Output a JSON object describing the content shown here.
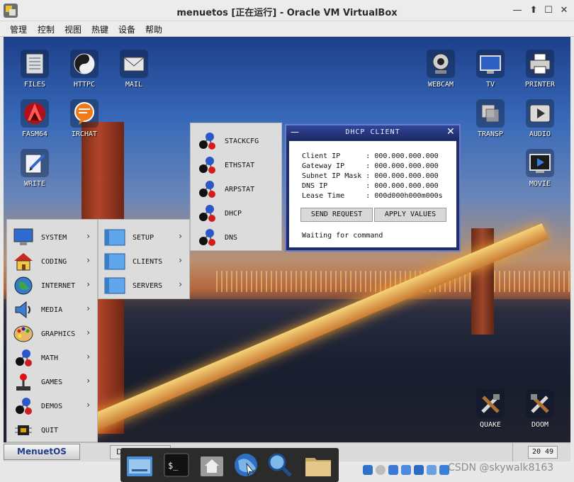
{
  "window": {
    "title": "menuetos [正在运行] - Oracle VM VirtualBox"
  },
  "menubar": [
    "管理",
    "控制",
    "视图",
    "热键",
    "设备",
    "帮助"
  ],
  "desktop_icons_left": [
    {
      "label": "FILES",
      "icon": "files-icon"
    },
    {
      "label": "HTTPC",
      "icon": "httpc-icon"
    },
    {
      "label": "MAIL",
      "icon": "mail-icon"
    },
    {
      "label": "FASM64",
      "icon": "fasm64-icon"
    },
    {
      "label": "IRCHAT",
      "icon": "irchat-icon"
    },
    {
      "label": "WRITE",
      "icon": "write-icon"
    }
  ],
  "desktop_icons_right": [
    {
      "label": "WEBCAM",
      "icon": "webcam-icon"
    },
    {
      "label": "TV",
      "icon": "tv-icon"
    },
    {
      "label": "PRINTER",
      "icon": "printer-icon"
    },
    {
      "label": "TRANSP",
      "icon": "transp-icon"
    },
    {
      "label": "AUDIO",
      "icon": "audio-icon"
    },
    {
      "label": "MOVIE",
      "icon": "movie-icon"
    },
    {
      "label": "QUAKE",
      "icon": "quake-icon"
    },
    {
      "label": "DOOM",
      "icon": "doom-icon"
    }
  ],
  "start_menu": [
    {
      "label": "SYSTEM",
      "arrow": "›"
    },
    {
      "label": "CODING",
      "arrow": "›"
    },
    {
      "label": "INTERNET",
      "arrow": "›"
    },
    {
      "label": "MEDIA",
      "arrow": "›"
    },
    {
      "label": "GRAPHICS",
      "arrow": "›"
    },
    {
      "label": "MATH",
      "arrow": "›"
    },
    {
      "label": "GAMES",
      "arrow": "›"
    },
    {
      "label": "DEMOS",
      "arrow": "›"
    },
    {
      "label": "QUIT",
      "arrow": ""
    }
  ],
  "submenu_internet": [
    {
      "label": "SETUP",
      "arrow": "›"
    },
    {
      "label": "CLIENTS",
      "arrow": "›"
    },
    {
      "label": "SERVERS",
      "arrow": "›"
    }
  ],
  "submenu_setup": [
    "STACKCFG",
    "ETHSTAT",
    "ARPSTAT",
    "DHCP",
    "DNS"
  ],
  "dhcp": {
    "title": "DHCP CLIENT",
    "lines": [
      "Client IP      : 000.000.000.000",
      "Gateway IP     : 000.000.000.000",
      "Subnet IP Mask : 000.000.000.000",
      "DNS IP         : 000.000.000.000",
      "Lease Time     : 000d000h000m000s"
    ],
    "send_button": "SEND REQUEST",
    "apply_button": "APPLY VALUES",
    "status": "Waiting for command"
  },
  "taskbar": {
    "menuet_button": "MenuetOS",
    "task": "DHCP",
    "clock": "20 49"
  },
  "watermark": "CSDN @skywalk8163",
  "colors": {
    "window_blue": "#1f2d6b",
    "menu_gray": "#dcdcdc",
    "brand_blue": "#1f3e8c"
  }
}
